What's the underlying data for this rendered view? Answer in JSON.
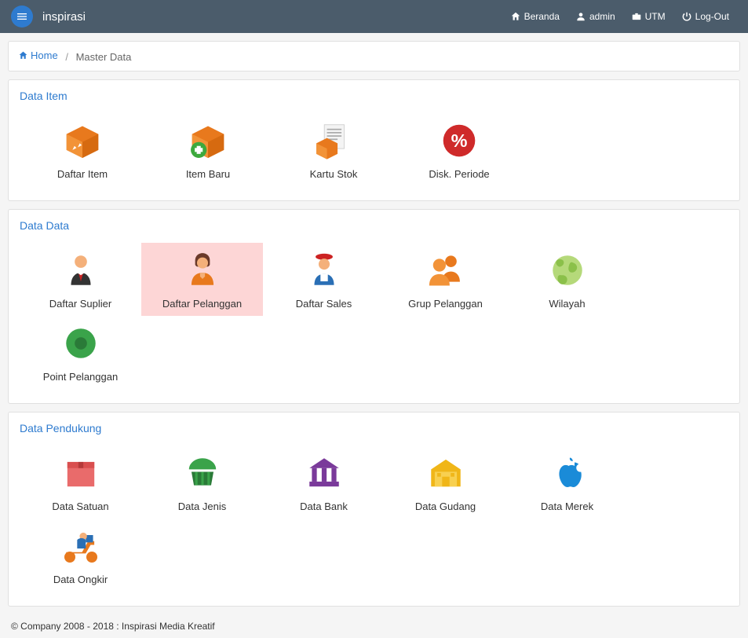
{
  "navbar": {
    "brand": "inspirasi",
    "links": {
      "beranda": "Beranda",
      "user": "admin",
      "utm": "UTM",
      "logout": "Log-Out"
    }
  },
  "breadcrumb": {
    "home": "Home",
    "current": "Master Data",
    "sep": "/"
  },
  "sections": {
    "data_item": {
      "title": "Data Item",
      "tiles": {
        "daftar_item": "Daftar Item",
        "item_baru": "Item Baru",
        "kartu_stok": "Kartu Stok",
        "disk_periode": "Disk. Periode"
      }
    },
    "data_data": {
      "title": "Data Data",
      "tiles": {
        "daftar_suplier": "Daftar Suplier",
        "daftar_pelanggan": "Daftar Pelanggan",
        "daftar_sales": "Daftar Sales",
        "grup_pelanggan": "Grup Pelanggan",
        "wilayah": "Wilayah",
        "point_pelanggan": "Point Pelanggan"
      }
    },
    "data_pendukung": {
      "title": "Data Pendukung",
      "tiles": {
        "data_satuan": "Data Satuan",
        "data_jenis": "Data Jenis",
        "data_bank": "Data Bank",
        "data_gudang": "Data Gudang",
        "data_merek": "Data Merek",
        "data_ongkir": "Data Ongkir"
      }
    }
  },
  "footer": "© Company 2008 - 2018 : Inspirasi Media Kreatif"
}
